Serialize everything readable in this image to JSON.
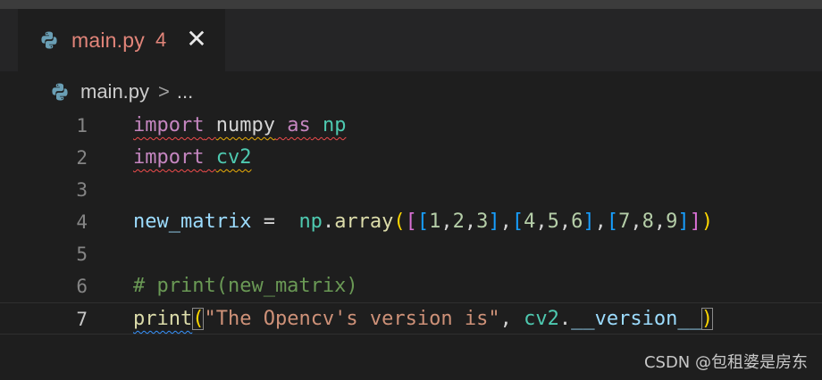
{
  "tab": {
    "filename": "main.py",
    "problem_count": "4",
    "close_glyph": "✕",
    "icon": "python-icon",
    "filename_color": "#e2857a"
  },
  "breadcrumb": {
    "file": "main.py",
    "separator": ">",
    "more": "..."
  },
  "editor": {
    "line_numbers": [
      "1",
      "2",
      "3",
      "4",
      "5",
      "6",
      "7"
    ],
    "active_line": "7",
    "lines": {
      "l1": {
        "t1": "import",
        "t2": " ",
        "t3": "numpy",
        "t4": " ",
        "t5": "as",
        "t6": " ",
        "t7": "np"
      },
      "l2": {
        "t1": "import",
        "t2": " ",
        "t3": "cv2"
      },
      "l4": {
        "t1": "new_matrix",
        "t2": " =  ",
        "t3": "np",
        "t4": ".",
        "t5": "array",
        "t6": "(",
        "t7": "[",
        "t8": "[",
        "t9": "1",
        "t10": ",",
        "t11": "2",
        "t12": ",",
        "t13": "3",
        "t14": "]",
        "t15": ",",
        "t16": "[",
        "t17": "4",
        "t18": ",",
        "t19": "5",
        "t20": ",",
        "t21": "6",
        "t22": "]",
        "t23": ",",
        "t24": "[",
        "t25": "7",
        "t26": ",",
        "t27": "8",
        "t28": ",",
        "t29": "9",
        "t30": "]",
        "t31": "]",
        "t32": ")"
      },
      "l6": {
        "t1": "# print(new_matrix)"
      },
      "l7": {
        "t1": "print",
        "t2": "(",
        "t3": "\"The Opencv's version is\"",
        "t4": ", ",
        "t5": "cv2",
        "t6": ".",
        "t7": "__version__",
        "t8": ")"
      }
    }
  },
  "watermark": "CSDN @包租婆是房东"
}
